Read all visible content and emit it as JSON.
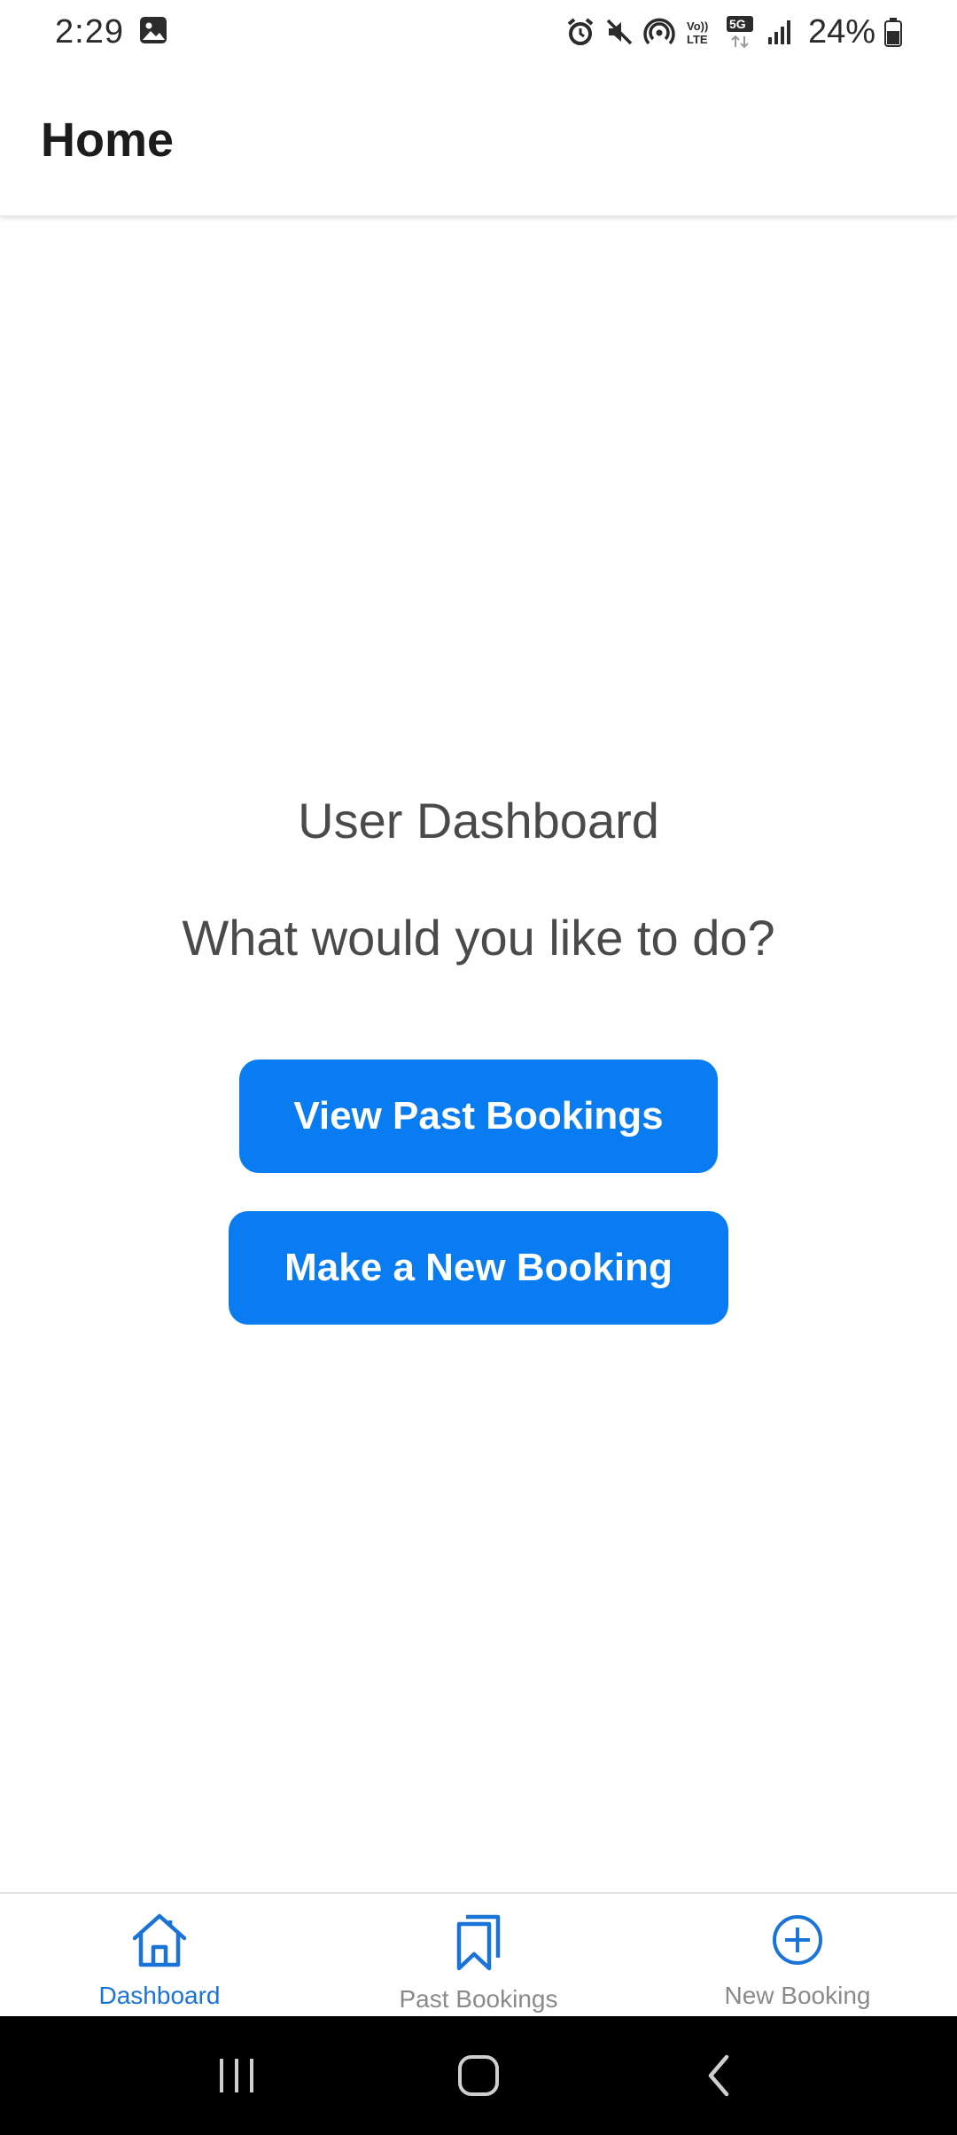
{
  "status_bar": {
    "time": "2:29",
    "battery": "24%",
    "network": "5G",
    "volte": "Vo) LTE"
  },
  "header": {
    "title": "Home"
  },
  "dashboard": {
    "title": "User Dashboard",
    "subtitle": "What would you like to do?",
    "view_past_label": "View Past Bookings",
    "new_booking_label": "Make a New Booking"
  },
  "bottom_nav": {
    "items": [
      {
        "label": "Dashboard",
        "icon": "home-icon",
        "active": true
      },
      {
        "label": "Past Bookings",
        "icon": "bookmarks-icon",
        "active": false
      },
      {
        "label": "New Booking",
        "icon": "plus-circle-icon",
        "active": false
      }
    ]
  },
  "colors": {
    "accent": "#0a7cf2",
    "nav_active": "#1a73d6",
    "nav_inactive": "#8a8a8a",
    "text": "#4a4a4a"
  }
}
